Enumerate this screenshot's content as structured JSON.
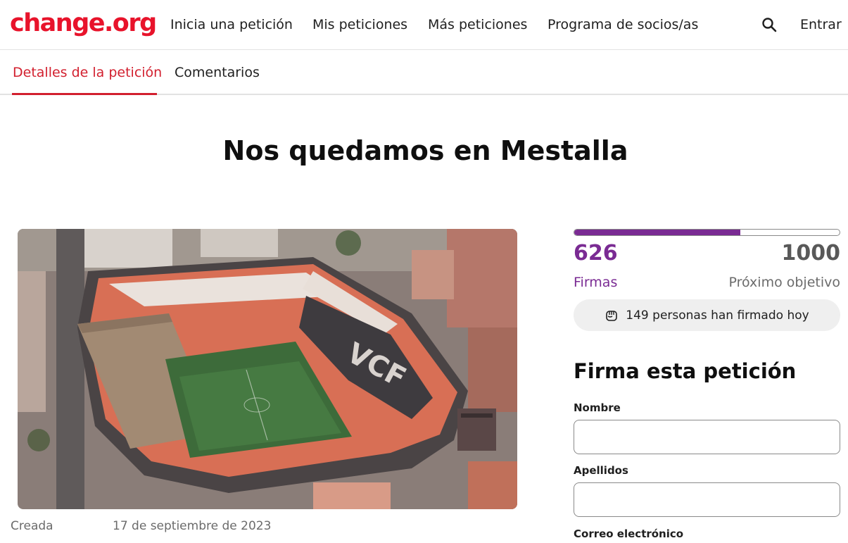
{
  "header": {
    "logo": "change.org",
    "nav": [
      "Inicia una petición",
      "Mis peticiones",
      "Más peticiones",
      "Programa de socios/as"
    ],
    "search_icon": "search-icon",
    "login": "Entrar"
  },
  "tabs": {
    "details": "Detalles de la petición",
    "comments": "Comentarios"
  },
  "petition": {
    "title": "Nos quedamos en Mestalla",
    "created_label": "Creada",
    "created_date": "17 de septiembre de 2023"
  },
  "progress": {
    "signatures": "626",
    "signatures_label": "Firmas",
    "goal": "1000",
    "goal_label": "Próximo objetivo",
    "fraction": 0.626,
    "today": "149 personas han firmado hoy"
  },
  "form": {
    "title": "Firma esta petición",
    "first_name_label": "Nombre",
    "first_name_value": "",
    "last_name_label": "Apellidos",
    "last_name_value": "",
    "email_label": "Correo electrónico"
  },
  "colors": {
    "brand": "#e8132b",
    "tab_active": "#d2202f",
    "progress": "#7a2b93"
  }
}
